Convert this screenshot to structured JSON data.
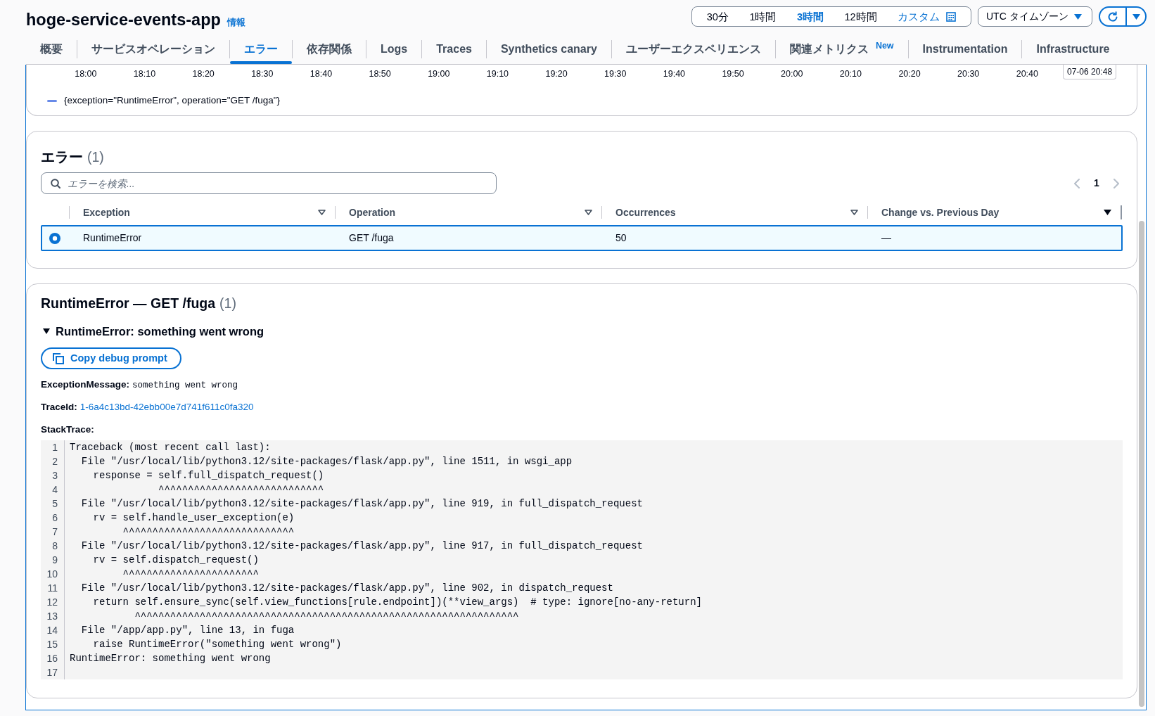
{
  "header": {
    "title": "hoge-service-events-app",
    "info_link": "情報"
  },
  "time_range": [
    {
      "label": "30分",
      "selected": false,
      "kind": "preset"
    },
    {
      "label": "1時間",
      "selected": false,
      "kind": "preset"
    },
    {
      "label": "3時間",
      "selected": true,
      "kind": "preset"
    },
    {
      "label": "12時間",
      "selected": false,
      "kind": "preset"
    },
    {
      "label": "カスタム",
      "selected": false,
      "kind": "custom"
    }
  ],
  "timezone_select": {
    "value": "UTC タイムゾーン"
  },
  "tabs": [
    {
      "label": "概要",
      "selected": false
    },
    {
      "label": "サービスオペレーション",
      "selected": false
    },
    {
      "label": "エラー",
      "selected": true
    },
    {
      "label": "依存関係",
      "selected": false
    },
    {
      "label": "Logs",
      "selected": false
    },
    {
      "label": "Traces",
      "selected": false
    },
    {
      "label": "Synthetics canary",
      "selected": false
    },
    {
      "label": "ユーザーエクスペリエンス",
      "selected": false
    },
    {
      "label": "関連メトリクス",
      "selected": false,
      "badge": "New"
    },
    {
      "label": "Instrumentation",
      "selected": false
    },
    {
      "label": "Infrastructure",
      "selected": false
    }
  ],
  "chart": {
    "x_axis_labels": [
      "18:00",
      "18:10",
      "18:20",
      "18:30",
      "18:40",
      "18:50",
      "19:00",
      "19:10",
      "19:20",
      "19:30",
      "19:40",
      "19:50",
      "20:00",
      "20:10",
      "20:20",
      "20:30",
      "20:40"
    ],
    "hover_label": "07-06 20:48",
    "legend": [
      {
        "label": "{exception=\"RuntimeError\", operation=\"GET /fuga\"}",
        "color": "#688ae8"
      }
    ]
  },
  "errors_table": {
    "title": "エラー",
    "count": "(1)",
    "search": {
      "placeholder": "エラーを検索..."
    },
    "pagination": {
      "previous": {
        "disabled": true
      },
      "pages": [
        {
          "label": "1",
          "selected": true
        }
      ],
      "next": {
        "disabled": true
      }
    },
    "columns": [
      {
        "label": "Exception",
        "sorted": false
      },
      {
        "label": "Operation",
        "sorted": false
      },
      {
        "label": "Occurrences",
        "sorted": false
      },
      {
        "label": "Change vs. Previous Day",
        "sorted": true
      }
    ],
    "rows": [
      {
        "selected": true,
        "cells": [
          "RuntimeError",
          "GET /fuga",
          "50",
          "—"
        ]
      }
    ]
  },
  "error_detail": {
    "title": "RuntimeError — GET /fuga",
    "count": "(1)",
    "section": {
      "title": "RuntimeError: something went wrong",
      "expanded": true,
      "copy_button": "Copy debug prompt",
      "fields": [
        {
          "label": "ExceptionMessage:",
          "value": "something went wrong",
          "kind": "code"
        },
        {
          "label": "TraceId:",
          "value": "1-6a4c13bd-42ebb00e7d741f611c0fa320",
          "kind": "link"
        }
      ],
      "stack_trace": {
        "label": "StackTrace:",
        "lines": [
          {
            "number": "1",
            "text": "Traceback (most recent call last):"
          },
          {
            "number": "2",
            "text": "  File \"/usr/local/lib/python3.12/site-packages/flask/app.py\", line 1511, in wsgi_app"
          },
          {
            "number": "3",
            "text": "    response = self.full_dispatch_request()"
          },
          {
            "number": "4",
            "text": "               ^^^^^^^^^^^^^^^^^^^^^^^^^^^^"
          },
          {
            "number": "5",
            "text": "  File \"/usr/local/lib/python3.12/site-packages/flask/app.py\", line 919, in full_dispatch_request"
          },
          {
            "number": "6",
            "text": "    rv = self.handle_user_exception(e)"
          },
          {
            "number": "7",
            "text": "         ^^^^^^^^^^^^^^^^^^^^^^^^^^^^^"
          },
          {
            "number": "8",
            "text": "  File \"/usr/local/lib/python3.12/site-packages/flask/app.py\", line 917, in full_dispatch_request"
          },
          {
            "number": "9",
            "text": "    rv = self.dispatch_request()"
          },
          {
            "number": "10",
            "text": "         ^^^^^^^^^^^^^^^^^^^^^^^"
          },
          {
            "number": "11",
            "text": "  File \"/usr/local/lib/python3.12/site-packages/flask/app.py\", line 902, in dispatch_request"
          },
          {
            "number": "12",
            "text": "    return self.ensure_sync(self.view_functions[rule.endpoint])(**view_args)  # type: ignore[no-any-return]"
          },
          {
            "number": "13",
            "text": "           ^^^^^^^^^^^^^^^^^^^^^^^^^^^^^^^^^^^^^^^^^^^^^^^^^^^^^^^^^^^^^^^^^"
          },
          {
            "number": "14",
            "text": "  File \"/app/app.py\", line 13, in fuga"
          },
          {
            "number": "15",
            "text": "    raise RuntimeError(\"something went wrong\")"
          },
          {
            "number": "16",
            "text": "RuntimeError: something went wrong"
          },
          {
            "number": "17"
          }
        ]
      }
    }
  }
}
